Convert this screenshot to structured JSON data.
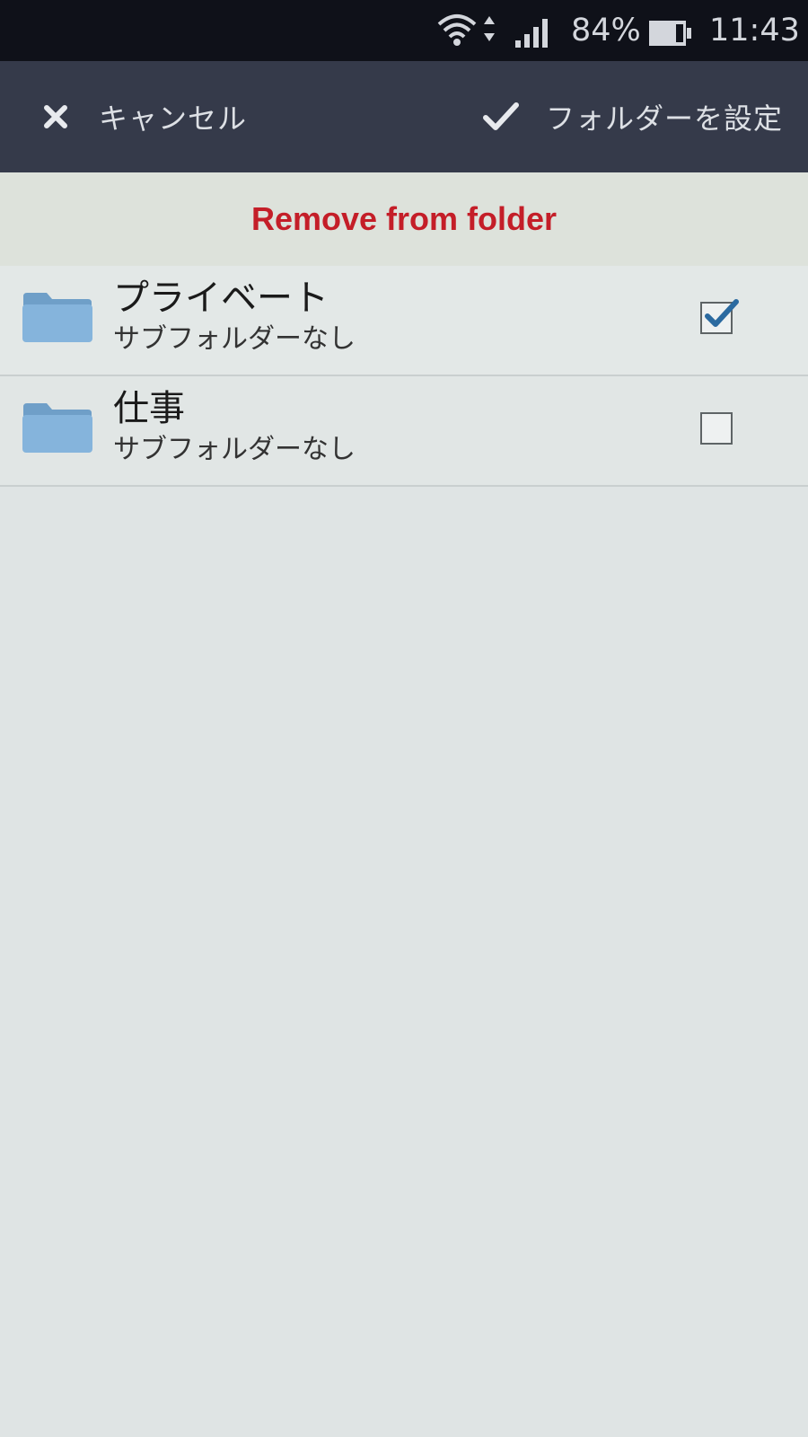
{
  "status_bar": {
    "battery_percent": "84%",
    "time": "11:43",
    "icons": [
      "wifi-icon",
      "data-arrows-icon",
      "signal-icon",
      "battery-icon"
    ]
  },
  "action_bar": {
    "cancel_label": "キャンセル",
    "cancel_icon": "close-icon",
    "confirm_label": "フォルダーを設定",
    "confirm_icon": "check-icon"
  },
  "banner": {
    "label": "Remove from folder",
    "color": "#c41e28"
  },
  "folders": [
    {
      "name": "プライベート",
      "subtitle": "サブフォルダーなし",
      "checked": true,
      "icon": "folder-icon"
    },
    {
      "name": "仕事",
      "subtitle": "サブフォルダーなし",
      "checked": false,
      "icon": "folder-icon"
    }
  ]
}
